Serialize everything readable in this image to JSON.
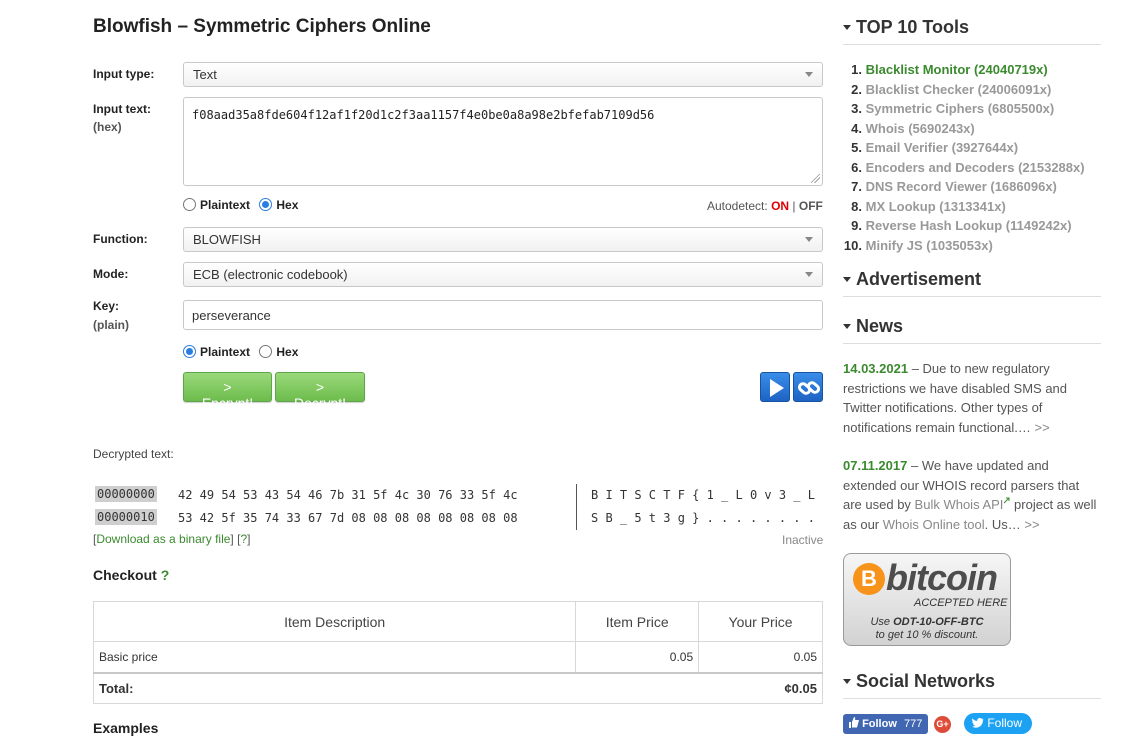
{
  "page": {
    "title": "Blowfish – Symmetric Ciphers Online"
  },
  "form": {
    "input_type": {
      "label": "Input type:",
      "value": "Text"
    },
    "input_text": {
      "label": "Input text:",
      "sublabel": "(hex)",
      "value": "f08aad35a8fde604f12af1f20d1c2f3aa1157f4e0be0a8a98e2bfefab7109d56"
    },
    "input_format": {
      "options": [
        "Plaintext",
        "Hex"
      ],
      "selected": "Hex"
    },
    "autodetect": {
      "label": "Autodetect:",
      "on": "ON",
      "sep": "|",
      "off": "OFF"
    },
    "function": {
      "label": "Function:",
      "value": "BLOWFISH"
    },
    "mode": {
      "label": "Mode:",
      "value": "ECB (electronic codebook)"
    },
    "key": {
      "label": "Key:",
      "sublabel": "(plain)",
      "value": "perseverance"
    },
    "key_format": {
      "options": [
        "Plaintext",
        "Hex"
      ],
      "selected": "Plaintext"
    },
    "buttons": {
      "encrypt": "> Encrypt!",
      "decrypt": "> Decrypt!"
    }
  },
  "output": {
    "label": "Decrypted text:",
    "rows": [
      {
        "offset": "00000000",
        "hex": "42 49 54 53 43 54 46 7b 31 5f 4c 30 76 33 5f 4c",
        "ascii": "B I T S C T F { 1 _ L 0 v 3 _ L"
      },
      {
        "offset": "00000010",
        "hex": "53 42 5f 35 74 33 67 7d 08 08 08 08 08 08 08 08",
        "ascii": "S B _ 5 t 3 g } . . . . . . . ."
      }
    ],
    "download_link": "Download as a binary file",
    "help_link": "?",
    "status": "Inactive"
  },
  "checkout": {
    "title": "Checkout",
    "help": "?",
    "headers": [
      "Item Description",
      "Item Price",
      "Your Price"
    ],
    "rows": [
      {
        "description": "Basic price",
        "item_price": "0.05",
        "your_price": "0.05"
      }
    ],
    "total_label": "Total:",
    "total_value": "¢0.05"
  },
  "examples": {
    "title": "Examples"
  },
  "sidebar": {
    "top_tools": {
      "title": "TOP 10 Tools",
      "items": [
        {
          "num": "1.",
          "label": "Blacklist Monitor (24040719x)"
        },
        {
          "num": "2.",
          "label": "Blacklist Checker (24006091x)"
        },
        {
          "num": "3.",
          "label": "Symmetric Ciphers (6805500x)"
        },
        {
          "num": "4.",
          "label": "Whois (5690243x)"
        },
        {
          "num": "5.",
          "label": "Email Verifier (3927644x)"
        },
        {
          "num": "6.",
          "label": "Encoders and Decoders (2153288x)"
        },
        {
          "num": "7.",
          "label": "DNS Record Viewer (1686096x)"
        },
        {
          "num": "8.",
          "label": "MX Lookup (1313341x)"
        },
        {
          "num": "9.",
          "label": "Reverse Hash Lookup (1149242x)"
        },
        {
          "num": "10.",
          "label": "Minify JS (1035053x)"
        }
      ]
    },
    "advertisement": {
      "title": "Advertisement"
    },
    "news": {
      "title": "News",
      "items": [
        {
          "date": "14.03.2021",
          "text": " – Due to new regulatory restrictions we have disabled SMS and Twitter notifications. Other types of notifications remain functional.…",
          "more": " >>"
        },
        {
          "date": "07.11.2017",
          "text_a": " – We have updated and extended our WHOIS record parsers that are used by ",
          "link_a": "Bulk Whois API",
          "text_b": " project as well as our ",
          "link_b": "Whois Online tool",
          "text_c": ". Us…",
          "more": " >>"
        }
      ]
    },
    "bitcoin": {
      "word": "bitcoin",
      "coin_symbol": "B",
      "accepted": "ACCEPTED HERE",
      "use_prefix": "Use ",
      "code": "ODT-10-OFF-BTC",
      "discount": "to get 10 % discount."
    },
    "social": {
      "title": "Social Networks",
      "fb_label": "Follow",
      "fb_count": "777",
      "gplus": "G+",
      "twitter_label": "Follow"
    }
  },
  "colors": {
    "accent_green": "#3b8a2f",
    "button_green": "#6dbc4c",
    "autodetect_on": "#e00000",
    "radio_blue": "#2a7de1"
  }
}
